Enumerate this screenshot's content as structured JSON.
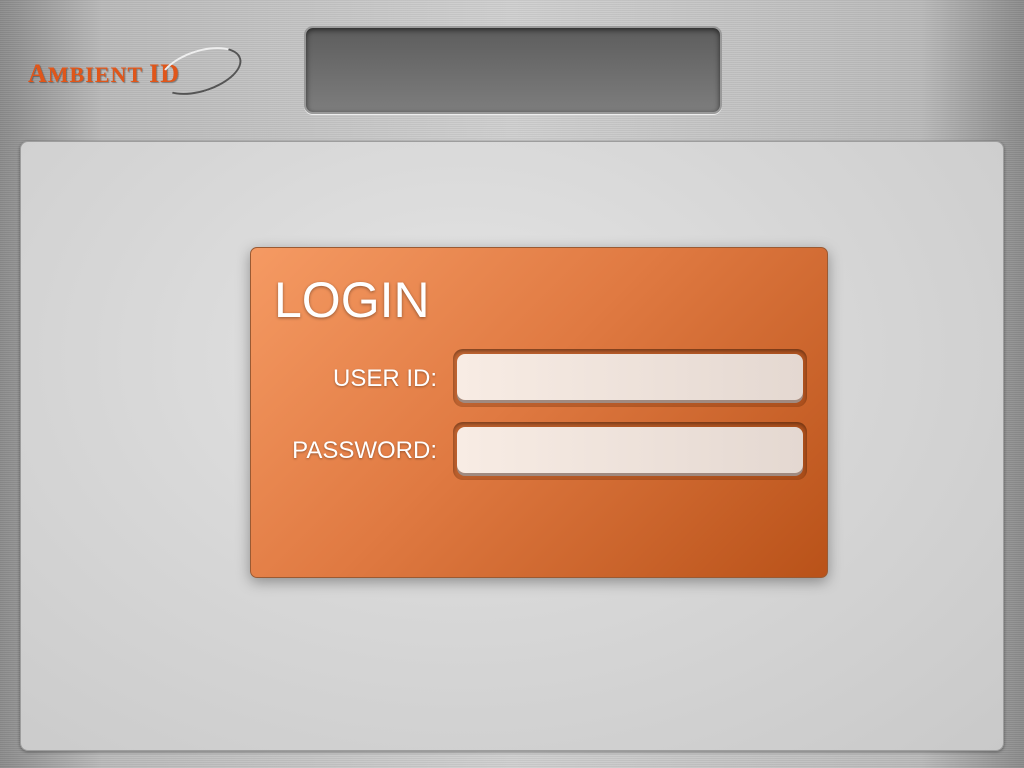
{
  "brand": {
    "logo_text": "AMBIENT ID"
  },
  "login": {
    "title": "LOGIN",
    "user_id_label": "USER ID:",
    "password_label": "PASSWORD:",
    "user_id_value": "",
    "password_value": ""
  },
  "colors": {
    "accent": "#e07a42",
    "logo": "#e0561a"
  }
}
